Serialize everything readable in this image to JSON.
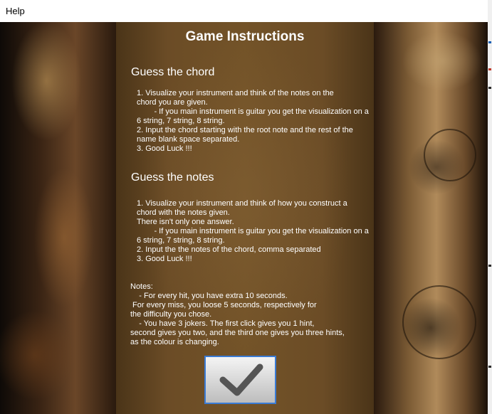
{
  "window": {
    "title": "Help"
  },
  "panel": {
    "heading": "Game Instructions",
    "sections": [
      {
        "title": "Guess the chord",
        "body": "1. Visualize your instrument and think of the notes on the\nchord you are given.\n        - If you main instrument is guitar you get the visualization on a\n6 string, 7 string, 8 string.\n2. Input the chord starting with the root note and the rest of the\nname blank space separated.\n3. Good Luck !!!"
      },
      {
        "title": "Guess the notes",
        "body": "1. Visualize your instrument and think of how you construct a\nchord with the notes given.\nThere isn't only one answer.\n        - If you main instrument is guitar you get the visualization on a\n6 string, 7 string, 8 string.\n2. Input the the notes of the chord, comma separated\n3. Good Luck !!!"
      }
    ],
    "notes": "Notes:\n    - For every hit, you have extra 10 seconds.\n For every miss, you loose 5 seconds, respectively for\nthe difficulty you chose.\n    - You have 3 jokers. The first click gives you 1 hint,\nsecond gives you two, and the third one gives you three hints,\nas the colour is changing."
  },
  "ok_button": {
    "icon": "checkmark-icon"
  },
  "colors": {
    "panel_bg": "#735328",
    "text": "#ffffff",
    "button_border": "#3a7bd5",
    "checkmark": "#555555"
  }
}
